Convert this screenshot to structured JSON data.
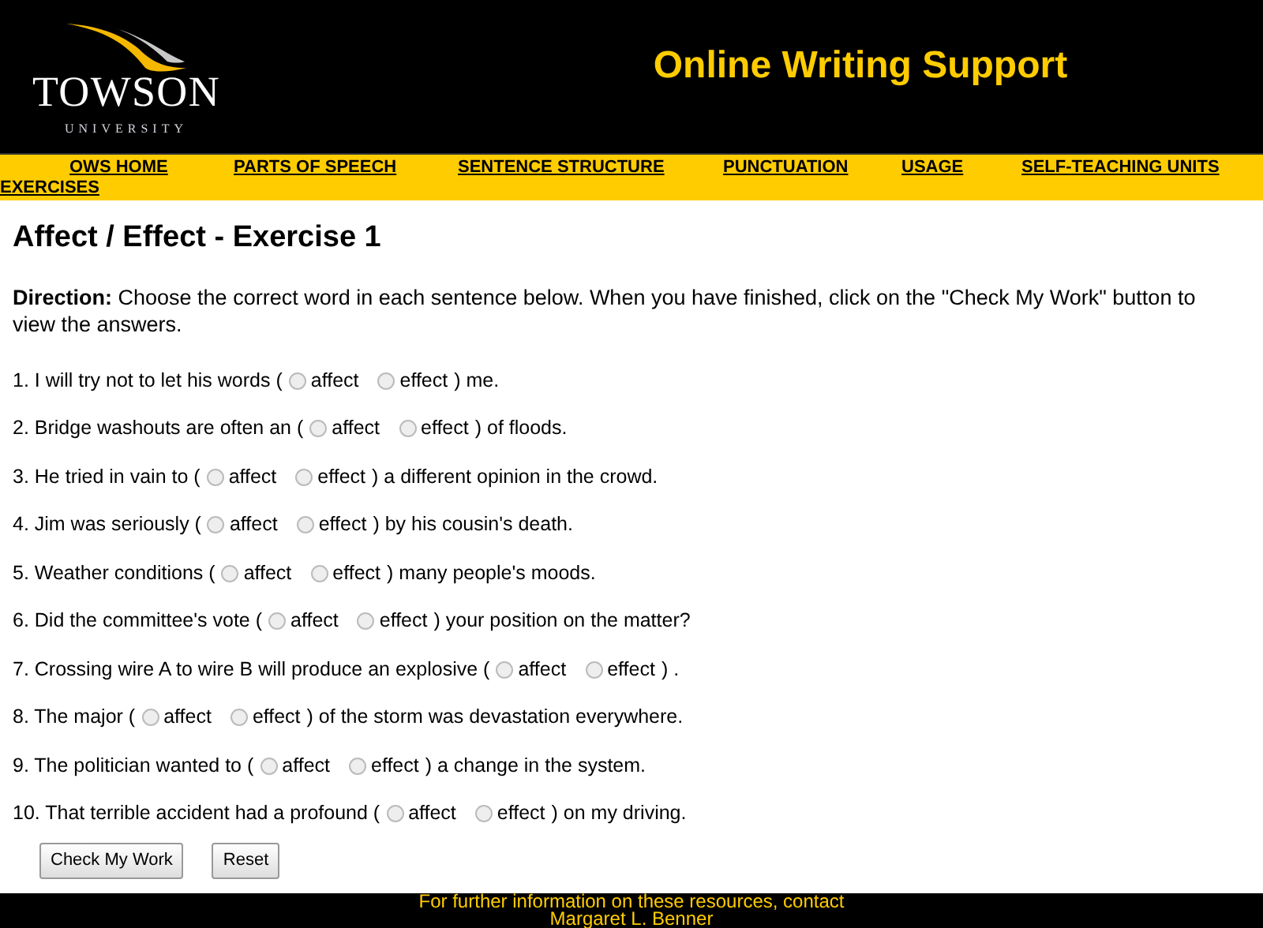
{
  "header": {
    "logo_name": "TOWSON",
    "logo_sub": "UNIVERSITY",
    "title": "Online Writing Support"
  },
  "nav": [
    "OWS HOME",
    "PARTS OF SPEECH",
    "SENTENCE STRUCTURE",
    "PUNCTUATION",
    "USAGE",
    "SELF-TEACHING UNITS",
    "EXERCISES"
  ],
  "heading": "Affect / Effect - Exercise 1",
  "direction": {
    "label": "Direction:",
    "text": "Choose the correct word in each sentence below. When you have finished, click on the \"Check My Work\" button to view the answers."
  },
  "questions": [
    {
      "before": "1. I will try not to let his words (",
      "options": [
        {
          "label": "affect",
          "selected": false
        },
        {
          "label": "effect",
          "selected": false
        }
      ],
      "after": ") me."
    },
    {
      "before": "2. Bridge washouts are often an (",
      "options": [
        {
          "label": "affect",
          "selected": false
        },
        {
          "label": "effect",
          "selected": false
        }
      ],
      "after": ") of floods."
    },
    {
      "before": "3. He tried in vain to (",
      "options": [
        {
          "label": "affect",
          "selected": false
        },
        {
          "label": "effect",
          "selected": false
        }
      ],
      "after": ") a different opinion in the crowd."
    },
    {
      "before": "4. Jim was seriously (",
      "options": [
        {
          "label": "affect",
          "selected": false
        },
        {
          "label": "effect",
          "selected": false
        }
      ],
      "after": ") by his cousin's death."
    },
    {
      "before": "5. Weather conditions (",
      "options": [
        {
          "label": "affect",
          "selected": false
        },
        {
          "label": "effect",
          "selected": false
        }
      ],
      "after": ") many people's moods."
    },
    {
      "before": "6. Did the committee's vote (",
      "options": [
        {
          "label": "affect",
          "selected": false
        },
        {
          "label": "effect",
          "selected": false
        }
      ],
      "after": ") your position on the matter?"
    },
    {
      "before": "7. Crossing wire A to wire B will produce an explosive (",
      "options": [
        {
          "label": "affect",
          "selected": false
        },
        {
          "label": "effect",
          "selected": false
        }
      ],
      "after": ") ."
    },
    {
      "before": "8. The major (",
      "options": [
        {
          "label": "affect",
          "selected": false
        },
        {
          "label": "effect",
          "selected": false
        }
      ],
      "after": ") of the storm was devastation everywhere."
    },
    {
      "before": "9. The politician wanted to (",
      "options": [
        {
          "label": "affect",
          "selected": false
        },
        {
          "label": "effect",
          "selected": false
        }
      ],
      "after": ") a change in the system."
    },
    {
      "before": "10. That terrible accident had a profound (",
      "options": [
        {
          "label": "affect",
          "selected": false
        },
        {
          "label": "effect",
          "selected": false
        }
      ],
      "after": ") on my driving."
    }
  ],
  "buttons": [
    "Check My Work",
    "Reset"
  ],
  "footer": [
    "For further information on these resources, contact",
    "Margaret L. Benner"
  ]
}
